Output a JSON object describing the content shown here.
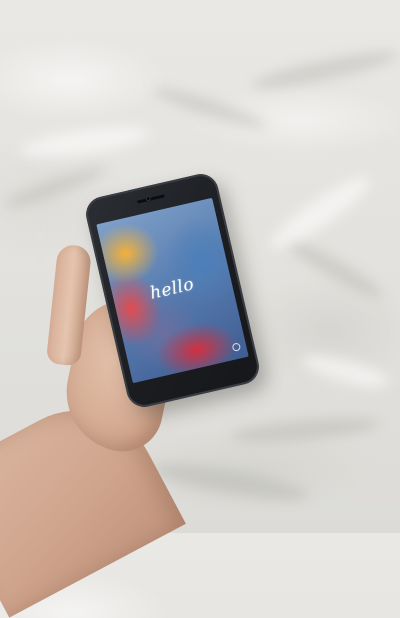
{
  "photo": {
    "subject": "",
    "background_color": "#e6e5e2"
  },
  "phone": {
    "screen": {
      "greeting": "hello",
      "status_time": "",
      "setup_hint": ""
    },
    "body_color": "#1f2226"
  },
  "icons": {
    "accessibility": "accessibility-icon"
  }
}
